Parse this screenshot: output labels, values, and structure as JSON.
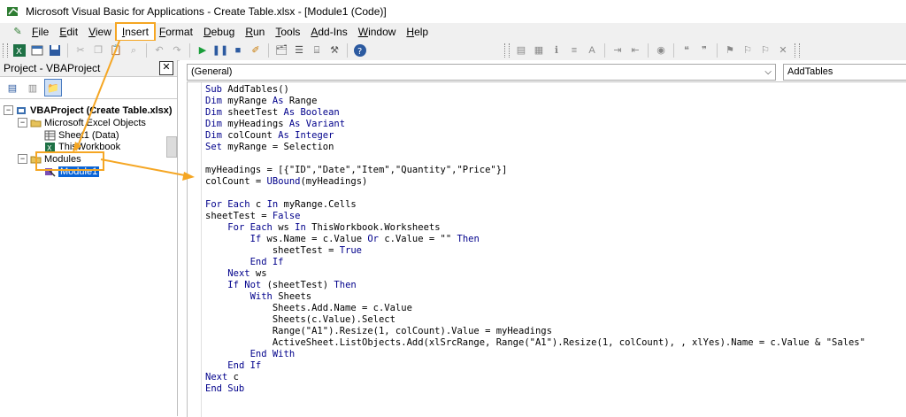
{
  "window": {
    "title": "Microsoft Visual Basic for Applications - Create Table.xlsx - [Module1 (Code)]"
  },
  "menu": [
    {
      "label": "File",
      "underline": "F",
      "rest": "ile"
    },
    {
      "label": "Edit",
      "underline": "E",
      "rest": "dit"
    },
    {
      "label": "View",
      "underline": "V",
      "rest": "iew"
    },
    {
      "label": "Insert",
      "underline": "I",
      "rest": "nsert",
      "highlighted": true
    },
    {
      "label": "Format",
      "underline": "F",
      "rest": "ormat"
    },
    {
      "label": "Debug",
      "underline": "D",
      "rest": "ebug"
    },
    {
      "label": "Run",
      "underline": "R",
      "rest": "un"
    },
    {
      "label": "Tools",
      "underline": "T",
      "rest": "ools"
    },
    {
      "label": "Add-Ins",
      "underline": "A",
      "rest": "dd-Ins"
    },
    {
      "label": "Window",
      "underline": "W",
      "rest": "indow"
    },
    {
      "label": "Help",
      "underline": "H",
      "rest": "elp"
    }
  ],
  "project": {
    "header": "Project - VBAProject",
    "tree": {
      "root": "VBAProject (Create Table.xlsx)",
      "excel_objects": "Microsoft Excel Objects",
      "sheet1": "Sheet1 (Data)",
      "thisworkbook": "ThisWorkbook",
      "modules": "Modules",
      "module1": "Module1"
    }
  },
  "code_window": {
    "object_combo": "(General)",
    "proc_combo": "AddTables",
    "lines": [
      [
        [
          "kw",
          "Sub "
        ],
        [
          "",
          "AddTables()"
        ]
      ],
      [
        [
          "kw",
          "Dim "
        ],
        [
          "",
          "myRange "
        ],
        [
          "kw",
          "As "
        ],
        [
          "",
          "Range"
        ]
      ],
      [
        [
          "kw",
          "Dim "
        ],
        [
          "",
          "sheetTest "
        ],
        [
          "kw",
          "As Boolean"
        ]
      ],
      [
        [
          "kw",
          "Dim "
        ],
        [
          "",
          "myHeadings "
        ],
        [
          "kw",
          "As Variant"
        ]
      ],
      [
        [
          "kw",
          "Dim "
        ],
        [
          "",
          "colCount "
        ],
        [
          "kw",
          "As Integer"
        ]
      ],
      [
        [
          "kw",
          "Set "
        ],
        [
          "",
          "myRange = Selection"
        ]
      ],
      [],
      [
        [
          "",
          "myHeadings = [{\"ID\",\"Date\",\"Item\",\"Quantity\",\"Price\"}]"
        ]
      ],
      [
        [
          "",
          "colCount = "
        ],
        [
          "kw",
          "UBound"
        ],
        [
          "",
          "(myHeadings)"
        ]
      ],
      [],
      [
        [
          "kw",
          "For Each "
        ],
        [
          "",
          "c "
        ],
        [
          "kw",
          "In "
        ],
        [
          "",
          "myRange.Cells"
        ]
      ],
      [
        [
          "",
          "sheetTest = "
        ],
        [
          "kw",
          "False"
        ]
      ],
      [
        [
          "",
          "    "
        ],
        [
          "kw",
          "For Each "
        ],
        [
          "",
          "ws "
        ],
        [
          "kw",
          "In "
        ],
        [
          "",
          "ThisWorkbook.Worksheets"
        ]
      ],
      [
        [
          "",
          "        "
        ],
        [
          "kw",
          "If "
        ],
        [
          "",
          "ws.Name = c.Value "
        ],
        [
          "kw",
          "Or "
        ],
        [
          "",
          "c.Value = \"\" "
        ],
        [
          "kw",
          "Then"
        ]
      ],
      [
        [
          "",
          "            sheetTest = "
        ],
        [
          "kw",
          "True"
        ]
      ],
      [
        [
          "",
          "        "
        ],
        [
          "kw",
          "End If"
        ]
      ],
      [
        [
          "",
          "    "
        ],
        [
          "kw",
          "Next "
        ],
        [
          "",
          "ws"
        ]
      ],
      [
        [
          "",
          "    "
        ],
        [
          "kw",
          "If Not "
        ],
        [
          "",
          "(sheetTest) "
        ],
        [
          "kw",
          "Then"
        ]
      ],
      [
        [
          "",
          "        "
        ],
        [
          "kw",
          "With "
        ],
        [
          "",
          "Sheets"
        ]
      ],
      [
        [
          "",
          "            Sheets.Add.Name = c.Value"
        ]
      ],
      [
        [
          "",
          "            Sheets(c.Value).Select"
        ]
      ],
      [
        [
          "",
          "            Range(\"A1\").Resize(1, colCount).Value = myHeadings"
        ]
      ],
      [
        [
          "",
          "            ActiveSheet.ListObjects.Add(xlSrcRange, Range(\"A1\").Resize(1, colCount), , xlYes).Name = c.Value & \"Sales\""
        ]
      ],
      [
        [
          "",
          "        "
        ],
        [
          "kw",
          "End With"
        ]
      ],
      [
        [
          "",
          "    "
        ],
        [
          "kw",
          "End If"
        ]
      ],
      [
        [
          "kw",
          "Next "
        ],
        [
          "",
          "c"
        ]
      ],
      [
        [
          "kw",
          "End Sub"
        ]
      ]
    ]
  },
  "colors": {
    "accent_callout": "#f5a623",
    "selection": "#0a64d6",
    "keyword": "#00008b"
  }
}
